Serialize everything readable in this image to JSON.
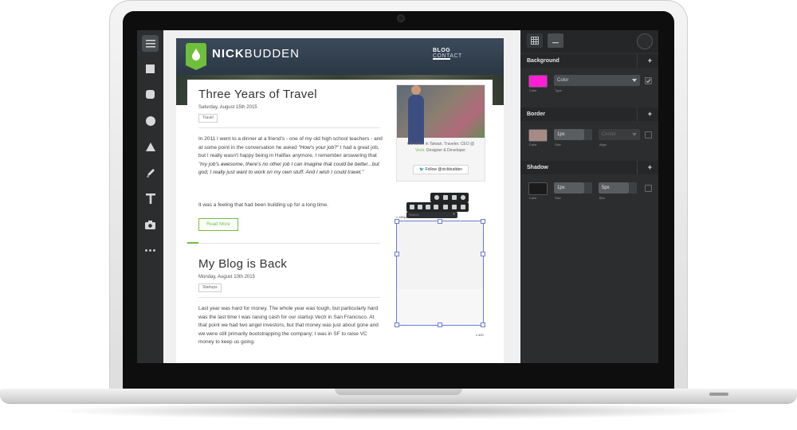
{
  "site": {
    "logo_bold": "NICK",
    "logo_light": "BUDDEN",
    "nav": [
      "BLOG",
      "CONTACT"
    ]
  },
  "posts": [
    {
      "title": "Three Years of Travel",
      "date": "Saturday, August 15th 2015",
      "tag": "Travel",
      "p1_a": "In 2011 I went to a dinner at a friend's - one of my old high school teachers - and at some point in the conversation he asked ",
      "p1_b": "\"How's your job?\"",
      "p1_c": " I had a great job, but I really wasn't happy being in Halifax anymore. I remember answering that ",
      "p1_d": "\"my job's awesome, there's no other job I can imagine that could be better...but god, I really just want to work on my own stuff. And I wish I could travel.\"",
      "p2": "It was a feeling that had been building up for a long time.",
      "read_more": "Read More"
    },
    {
      "title": "My Blog is Back",
      "date": "Monday, August 10th 2015",
      "tag": "Startups",
      "p1": "Last year was hard for money. The whole year was tough, but particularly hard was the last time I was raising cash for our startup Vectr in San Francisco. At that point we had two angel investors, but that money was just about gone and we were still primarily bootstrapping the company; I was in SF to raise VC money to keep us going."
    }
  ],
  "profile": {
    "bio_a": "Canadian in Taiwan. Traveler. CEO @ ",
    "bio_link": "Vectr",
    "bio_b": ". Designer & Developer.",
    "follow": "Follow @nickbudden"
  },
  "selection": {
    "coords_top": "x 180px",
    "coords_bottom": "x 420"
  },
  "mini_toolbar": {
    "search_placeholder": "Search"
  },
  "panel": {
    "sections": {
      "background": {
        "title": "Background",
        "color_label": "Color",
        "type_label": "Type",
        "type_value": "Color",
        "swatch_color": "#ff1fd2"
      },
      "border": {
        "title": "Border",
        "color_label": "Color",
        "size_label": "Size",
        "size_value": "1px",
        "align_label": "Align",
        "align_value": "Center",
        "swatch_color": "#a58a86"
      },
      "shadow": {
        "title": "Shadow",
        "color_label": "Color",
        "size_label": "Size",
        "size_value": "1px",
        "blur_label": "Blur",
        "blur_value": "5px",
        "swatch_color": "#1b1b1b"
      }
    }
  },
  "tools": [
    "menu-icon",
    "rectangle-icon",
    "rounded-rectangle-icon",
    "circle-icon",
    "triangle-icon",
    "pen-icon",
    "text-icon",
    "image-icon",
    "more-icon"
  ],
  "colors": {
    "accent": "#6fbf3a",
    "selection": "#6a7bd6",
    "panel": "#2b2d2f"
  }
}
